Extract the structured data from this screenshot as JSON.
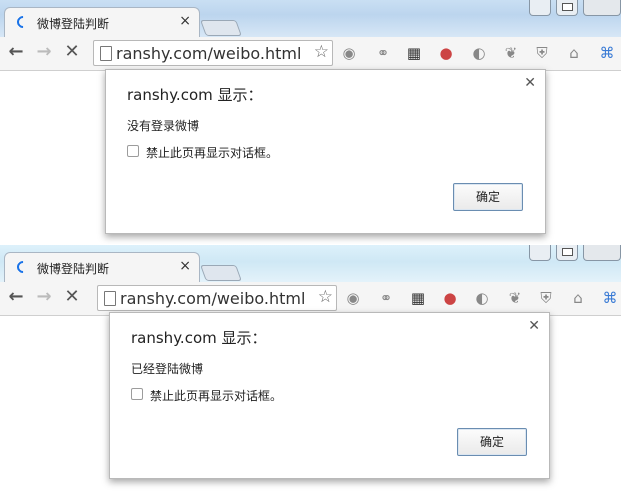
{
  "screens": [
    {
      "tab": {
        "title": "微博登陆判断"
      },
      "address": {
        "url": "ranshy.com/weibo.html"
      },
      "dialog": {
        "title": "ranshy.com 显示：",
        "message": "没有登录微博",
        "checkbox_label": "禁止此页再显示对话框。",
        "ok_label": "确定"
      }
    },
    {
      "tab": {
        "title": "微博登陆判断"
      },
      "address": {
        "url": "ranshy.com/weibo.html"
      },
      "dialog": {
        "title": "ranshy.com 显示：",
        "message": "已经登陆微博",
        "checkbox_label": "禁止此页再显示对话框。",
        "ok_label": "确定"
      }
    }
  ],
  "icons": {
    "nav": [
      "back-arrow-icon",
      "forward-arrow-icon",
      "stop-icon"
    ],
    "extensions": [
      "globe-icon",
      "share-icon",
      "qr-code-icon",
      "cookie-santa-icon",
      "swirl-icon",
      "leaf-icon",
      "shield-icon",
      "clean-icon",
      "command-icon"
    ]
  },
  "colors": {
    "accent": "#1a73e8",
    "titlebar_top": "#c9dff3",
    "titlebar_bottom": "#ddf1fb",
    "ok_border": "#6a8db1"
  }
}
